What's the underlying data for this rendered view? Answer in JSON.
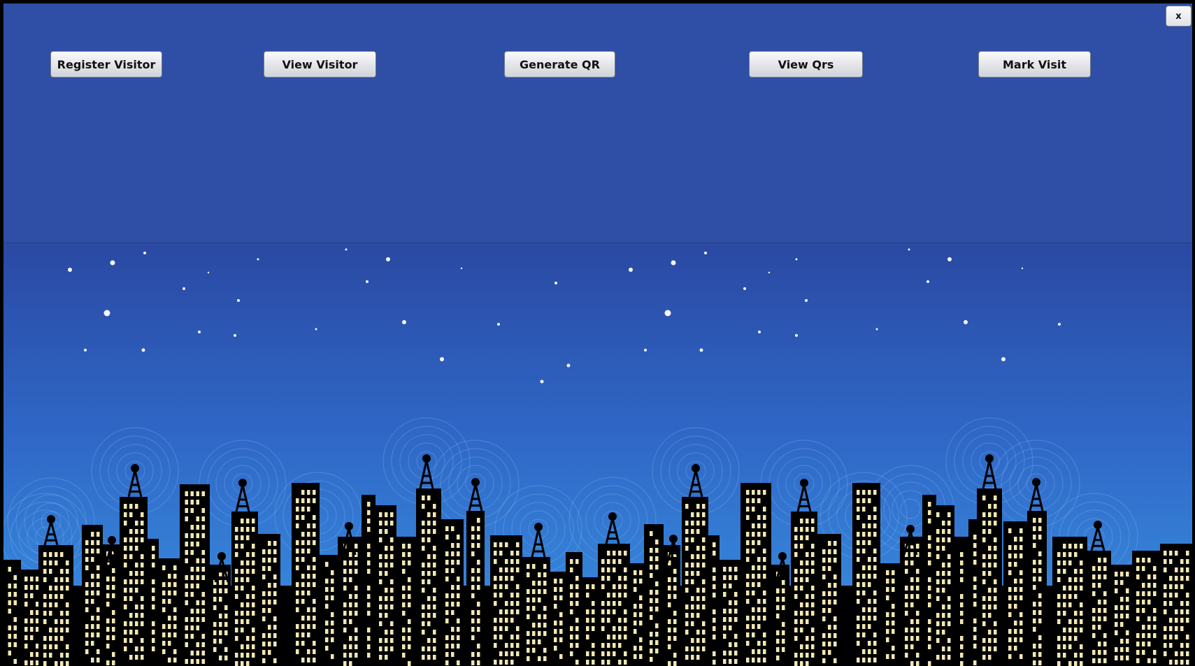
{
  "window": {
    "close_label": "x"
  },
  "toolbar": {
    "buttons": [
      {
        "label": "Register Visitor"
      },
      {
        "label": "View Visitor"
      },
      {
        "label": "Generate QR"
      },
      {
        "label": "View Qrs"
      },
      {
        "label": "Mark Visit"
      }
    ]
  },
  "colors": {
    "panel_background": "#2f4ea6",
    "sky_top": "#2a49a3",
    "sky_bottom": "#3a93e4",
    "skyline": "#000000",
    "windows": "#f2e7b4"
  },
  "background": {
    "icon": "city-skyline-with-radio-towers"
  }
}
